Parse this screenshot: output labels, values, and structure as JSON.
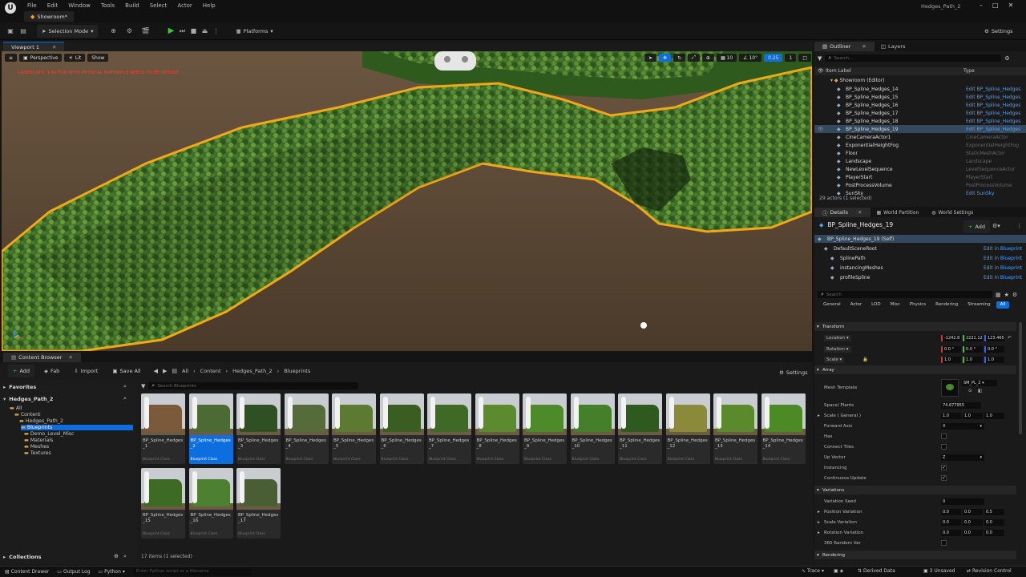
{
  "window": {
    "tab_label": "Showroom*",
    "project_title": "Hedges_Path_2",
    "controls": [
      "–",
      "□",
      "✕"
    ]
  },
  "menu": [
    "File",
    "Edit",
    "Window",
    "Tools",
    "Build",
    "Select",
    "Actor",
    "Help"
  ],
  "toolbar": {
    "selection_mode": "Selection Mode",
    "platforms": "Platforms",
    "settings": "Settings"
  },
  "viewport": {
    "tab": "Viewport 1",
    "perspective": "Perspective",
    "lit": "Lit",
    "show": "Show",
    "warning": "LANDSCAPE: 1 ACTOR WITH PHYSICAL MATERIALS NEEDS TO BE REBUILT",
    "grid_snap": "10",
    "rot_snap": "10°",
    "scale_snap": "0.25",
    "camera_speed": "1"
  },
  "content_browser": {
    "tab": "Content Browser",
    "add": "Add",
    "fab": "Fab",
    "import": "Import",
    "save_all": "Save All",
    "breadcrumbs": [
      "All",
      "Content",
      "Hedges_Path_2",
      "Blueprints"
    ],
    "settings": "Settings",
    "favorites": "Favorites",
    "project": "Hedges_Path_2",
    "search_placeholder": "Search Blueprints",
    "tree": [
      "All",
      "Content",
      "Hedges_Path_2",
      "Blueprints",
      "Demo_Level_Misc",
      "Materials",
      "Meshes",
      "Textures"
    ],
    "collections": "Collections",
    "item_count": "17 items (1 selected)",
    "asset_class": "Blueprint Class",
    "assets": [
      {
        "name": "BP_Spline_Hedges_1",
        "color": "#7a5a3a"
      },
      {
        "name": "BP_Spline_Hedges_2",
        "color": "#4c6a34"
      },
      {
        "name": "BP_Spline_Hedges_3",
        "color": "#2e5022"
      },
      {
        "name": "BP_Spline_Hedges_4",
        "color": "#556b3a"
      },
      {
        "name": "BP_Spline_Hedges_5",
        "color": "#5d7a33"
      },
      {
        "name": "BP_Spline_Hedges_6",
        "color": "#3a5e22"
      },
      {
        "name": "BP_Spline_Hedges_7",
        "color": "#3f6a26"
      },
      {
        "name": "BP_Spline_Hedges_8",
        "color": "#5c8a2e"
      },
      {
        "name": "BP_Spline_Hedges_9",
        "color": "#4d8a2a"
      },
      {
        "name": "BP_Spline_Hedges_10",
        "color": "#44802a"
      },
      {
        "name": "BP_Spline_Hedges_11",
        "color": "#2f5a1f"
      },
      {
        "name": "BP_Spline_Hedges_12",
        "color": "#8a8a3a"
      },
      {
        "name": "BP_Spline_Hedges_13",
        "color": "#5b8a2c"
      },
      {
        "name": "BP_Spline_Hedges_14",
        "color": "#4b8a25"
      },
      {
        "name": "BP_Spline_Hedges_15",
        "color": "#3d6a25"
      },
      {
        "name": "BP_Spline_Hedges_16",
        "color": "#4e8032"
      },
      {
        "name": "BP_Spline_Hedges_17",
        "color": "#4a5e33"
      }
    ]
  },
  "outliner": {
    "tab": "Outliner",
    "layers_tab": "Layers",
    "search_placeholder": "Search...",
    "col_label": "Item Label",
    "col_type": "Type",
    "root": "Showroom (Editor)",
    "items": [
      {
        "label": "BP_Spline_Hedges_14",
        "type": "Edit BP_Spline_Hedges",
        "link": true
      },
      {
        "label": "BP_Spline_Hedges_15",
        "type": "Edit BP_Spline_Hedges",
        "link": true
      },
      {
        "label": "BP_Spline_Hedges_16",
        "type": "Edit BP_Spline_Hedges",
        "link": true
      },
      {
        "label": "BP_Spline_Hedges_17",
        "type": "Edit BP_Spline_Hedges",
        "link": true
      },
      {
        "label": "BP_Spline_Hedges_18",
        "type": "Edit BP_Spline_Hedges",
        "link": true
      },
      {
        "label": "BP_Spline_Hedges_19",
        "type": "Edit BP_Spline_Hedges",
        "link": true
      },
      {
        "label": "CineCameraActor1",
        "type": "CineCameraActor",
        "link": false
      },
      {
        "label": "ExponentialHeightFog",
        "type": "ExponentialHeightFog",
        "link": false
      },
      {
        "label": "Floor",
        "type": "StaticMeshActor",
        "link": false
      },
      {
        "label": "Landscape",
        "type": "Landscape",
        "link": false
      },
      {
        "label": "NewLevelSequence",
        "type": "LevelSequenceActor",
        "link": false
      },
      {
        "label": "PlayerStart",
        "type": "PlayerStart",
        "link": false
      },
      {
        "label": "PostProcessVolume",
        "type": "PostProcessVolume",
        "link": false
      },
      {
        "label": "SunSky",
        "type": "Edit SunSky",
        "link": true
      }
    ],
    "status": "29 actors (1 selected)"
  },
  "details": {
    "tab": "Details",
    "world_partition_tab": "World Partition",
    "world_settings_tab": "World Settings",
    "actor_name": "BP_Spline_Hedges_19",
    "add": "Add",
    "components": [
      {
        "label": "BP_Spline_Hedges_19 (Self)",
        "link": ""
      },
      {
        "label": "DefaultSceneRoot",
        "link": "Edit in Blueprint"
      },
      {
        "label": "SplinePath",
        "link": "Edit in Blueprint"
      },
      {
        "label": "instancingMeshes",
        "link": "Edit in Blueprint"
      },
      {
        "label": "profileSpline",
        "link": "Edit in Blueprint"
      }
    ],
    "search_placeholder": "Search",
    "categories": [
      "General",
      "Actor",
      "LOD",
      "Misc",
      "Physics",
      "Rendering",
      "Streaming",
      "All"
    ],
    "transform": {
      "title": "Transform",
      "location_label": "Location",
      "location": [
        "-1242.8",
        "2221.12",
        "123.465"
      ],
      "rotation_label": "Rotation",
      "rotation": [
        "0.0 °",
        "0.0 °",
        "0.0 °"
      ],
      "scale_label": "Scale",
      "scale": [
        "1.0",
        "1.0",
        "1.0"
      ]
    },
    "array": {
      "title": "Array",
      "mesh_template_label": "Mesh Template",
      "mesh_template": "SM_PL_2",
      "space_label": "Space/ Plants",
      "space": "74.677955",
      "scale_general_label": "Scale ( General )",
      "scale_general": [
        "1.0",
        "1.0",
        "1.0"
      ],
      "forward_axis_label": "Forward Axis",
      "forward_axis": "X",
      "has_label": "Has",
      "connect_tiles_label": "Connect Tiles",
      "up_vector_label": "Up Vector",
      "up_vector": "Z",
      "instancing_label": "Instancing",
      "continuous_update_label": "Continuous Update"
    },
    "variations": {
      "title": "Variations",
      "seed_label": "Variation Seed",
      "seed": "0",
      "position_label": "Position Variation",
      "position": [
        "0.0",
        "0.0",
        "0.5"
      ],
      "scale_label": "Scale Variation",
      "scale": [
        "0.0",
        "0.0",
        "0.0"
      ],
      "rotation_label": "Rotation Variation",
      "rotation": [
        "0.0",
        "0.0",
        "0.0"
      ],
      "random_label": "360 Random Var"
    },
    "rendering_title": "Rendering"
  },
  "statusbar": {
    "content_drawer": "Content Drawer",
    "output_log": "Output Log",
    "python": "Python",
    "python_placeholder": "Enter Python script or a filename",
    "trace": "Trace",
    "derived_data": "Derived Data",
    "unsaved": "3 Unsaved",
    "revision": "Revision Control"
  },
  "colors": {
    "accent": "#0d6ee0",
    "link": "#4aa3ff",
    "warning": "#ff3b30",
    "selection_outline": "#f0a818",
    "play": "#3ec43e"
  }
}
